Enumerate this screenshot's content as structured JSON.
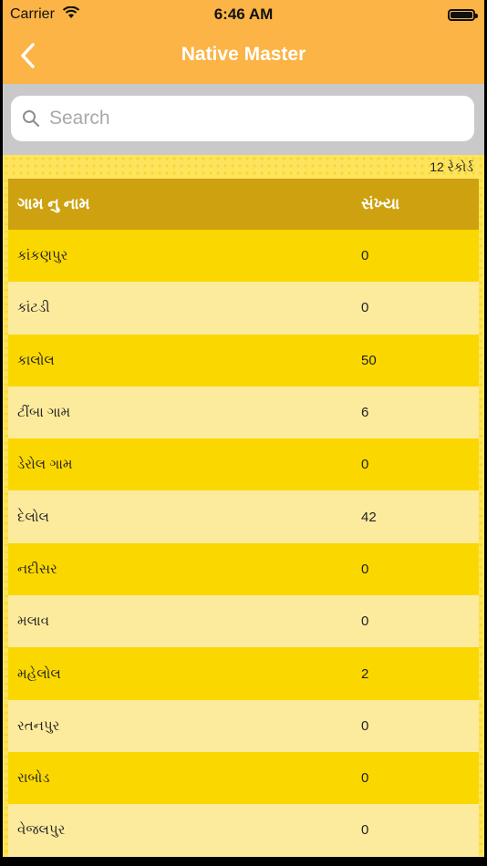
{
  "status": {
    "carrier": "Carrier",
    "time": "6:46 AM"
  },
  "nav": {
    "title": "Native Master"
  },
  "search": {
    "placeholder": "Search"
  },
  "records": {
    "count_label": "12 રેકોર્ડ"
  },
  "table": {
    "headers": {
      "name": "ગામ નુ નામ",
      "count": "સંખ્યા"
    },
    "rows": [
      {
        "name": "કાંકણપુર",
        "count": "0"
      },
      {
        "name": "કાંટડી",
        "count": "0"
      },
      {
        "name": "કાલોલ",
        "count": "50"
      },
      {
        "name": "ટીંબા ગામ",
        "count": "6"
      },
      {
        "name": "ડેરોલ ગામ",
        "count": "0"
      },
      {
        "name": "દેલોલ",
        "count": "42"
      },
      {
        "name": "નદીસર",
        "count": "0"
      },
      {
        "name": "મલાવ",
        "count": "0"
      },
      {
        "name": "મહેલોલ",
        "count": "2"
      },
      {
        "name": "રતનપુર",
        "count": "0"
      },
      {
        "name": "રાબોડ",
        "count": "0"
      },
      {
        "name": "વેજલપુર",
        "count": "0"
      }
    ]
  },
  "colors": {
    "header_bg": "#fbb445",
    "table_head_bg": "#cda10f",
    "row_odd": "#fbd700",
    "row_even": "#fdeb9d"
  }
}
